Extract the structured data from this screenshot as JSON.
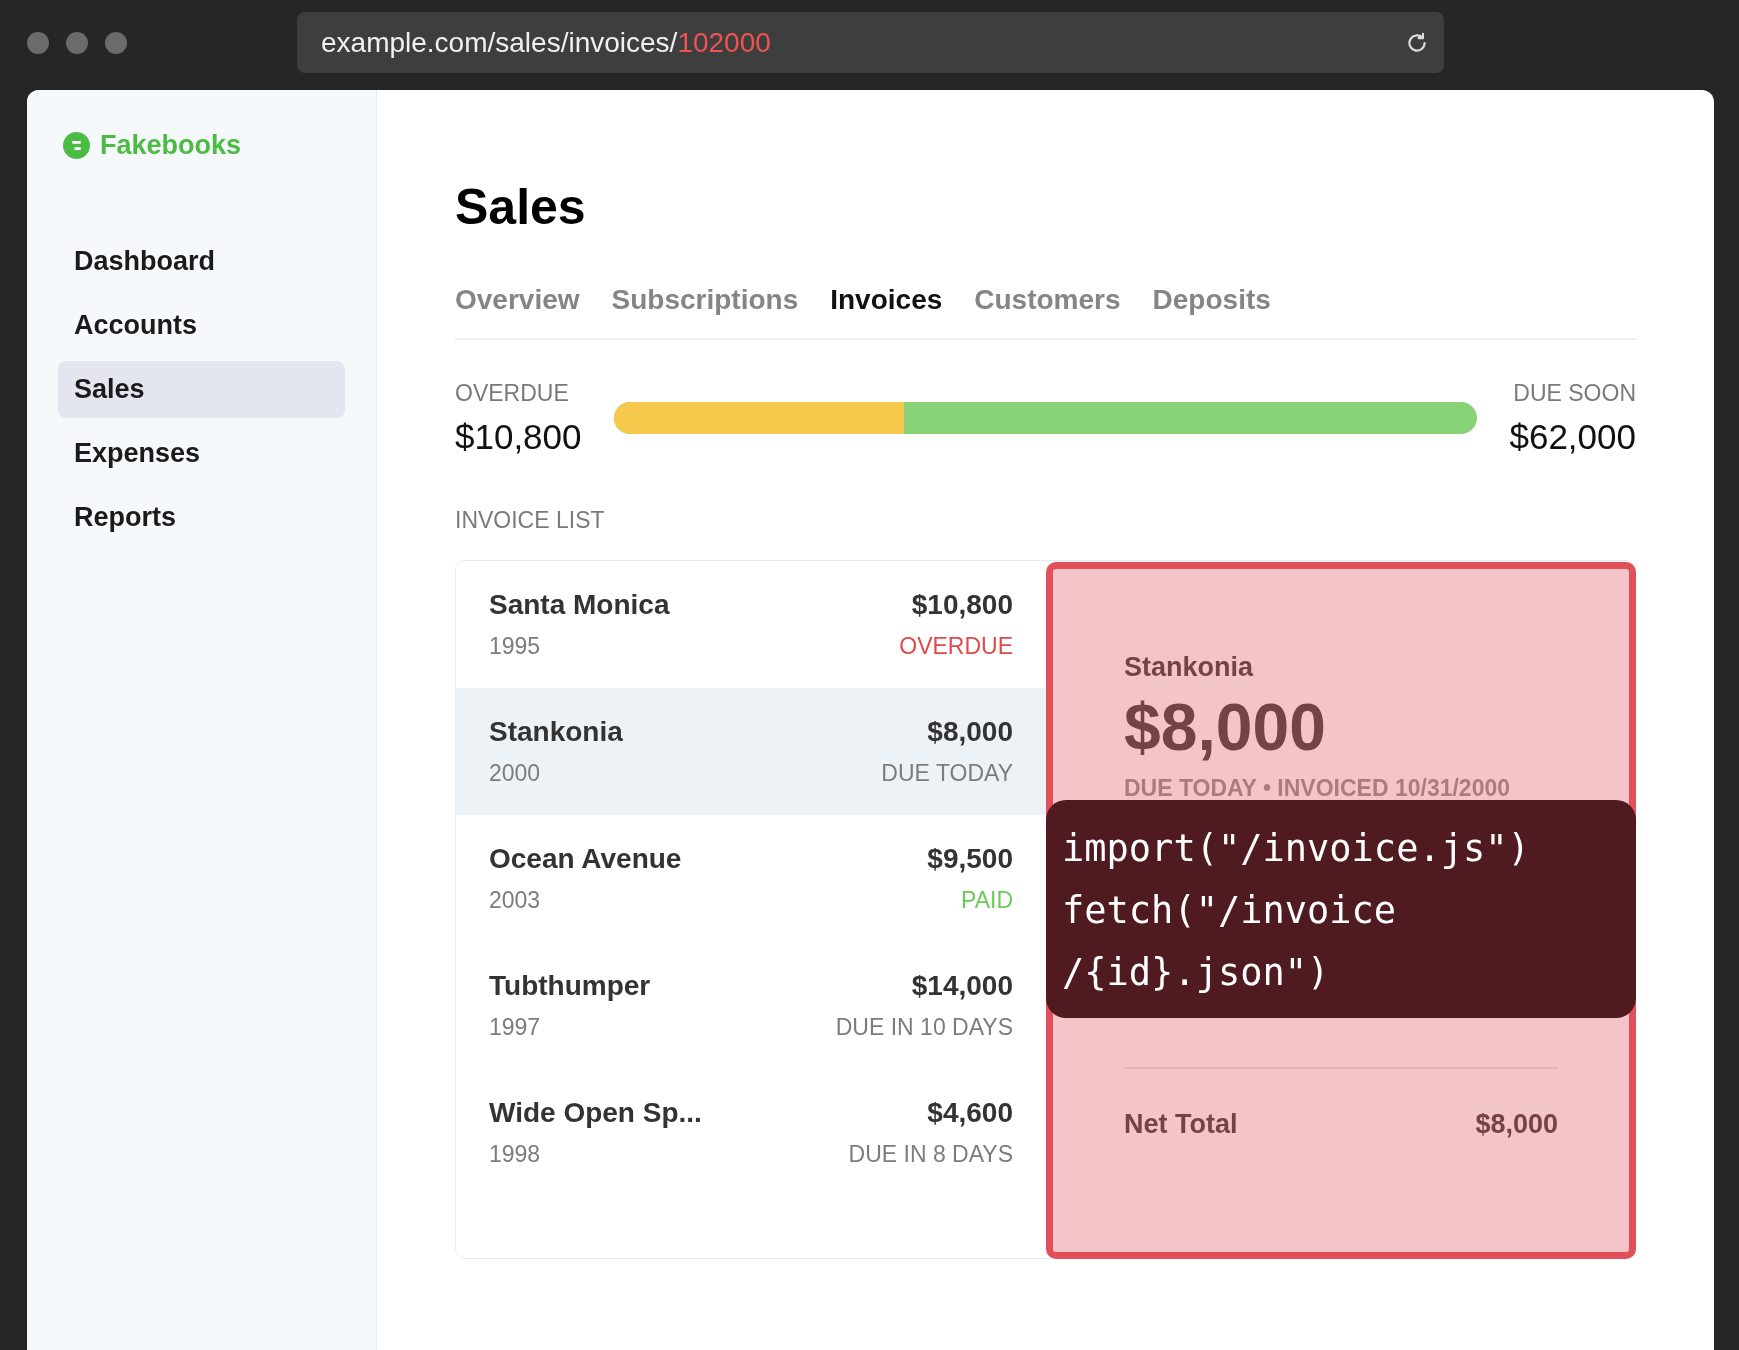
{
  "browser": {
    "url": "example.com/sales/invoices/",
    "url_highlight": "102000"
  },
  "sidebar": {
    "logo": "Fakebooks",
    "items": [
      {
        "label": "Dashboard",
        "selected": false
      },
      {
        "label": "Accounts",
        "selected": false
      },
      {
        "label": "Sales",
        "selected": true
      },
      {
        "label": "Expenses",
        "selected": false
      },
      {
        "label": "Reports",
        "selected": false
      }
    ]
  },
  "title": "Sales",
  "tabs": [
    {
      "label": "Overview",
      "selected": false
    },
    {
      "label": "Subscriptions",
      "selected": false
    },
    {
      "label": "Invoices",
      "selected": true
    },
    {
      "label": "Customers",
      "selected": false
    },
    {
      "label": "Deposits",
      "selected": false
    }
  ],
  "summary": {
    "overdue_label": "OVERDUE",
    "overdue_amount": "$10,800",
    "due_soon_label": "DUE SOON",
    "due_soon_amount": "$62,000",
    "level": 0.336
  },
  "invoice_list": {
    "heading": "INVOICE LIST",
    "rows": [
      {
        "name": "Santa Monica",
        "year": "1995",
        "amount": "$10,800",
        "status": "OVERDUE",
        "kind": "overdue",
        "selected": false
      },
      {
        "name": "Stankonia",
        "year": "2000",
        "amount": "$8,000",
        "status": "DUE TODAY",
        "kind": "due",
        "selected": true
      },
      {
        "name": "Ocean Avenue",
        "year": "2003",
        "amount": "$9,500",
        "status": "PAID",
        "kind": "paid",
        "selected": false
      },
      {
        "name": "Tubthumper",
        "year": "1997",
        "amount": "$14,000",
        "status": "DUE IN 10 DAYS",
        "kind": "due",
        "selected": false
      },
      {
        "name": "Wide Open Sp...",
        "year": "1998",
        "amount": "$4,600",
        "status": "DUE IN 8 DAYS",
        "kind": "due",
        "selected": false
      }
    ]
  },
  "detail": {
    "name": "Stankonia",
    "amount": "$8,000",
    "meta": "DUE TODAY • INVOICED 10/31/2000",
    "total_label": "Net Total",
    "total_amount": "$8,000"
  },
  "overlay": {
    "lines": [
      "import(\"/invoice.js\")",
      "fetch(\"/invoice",
      "/{id}.json\")"
    ]
  }
}
